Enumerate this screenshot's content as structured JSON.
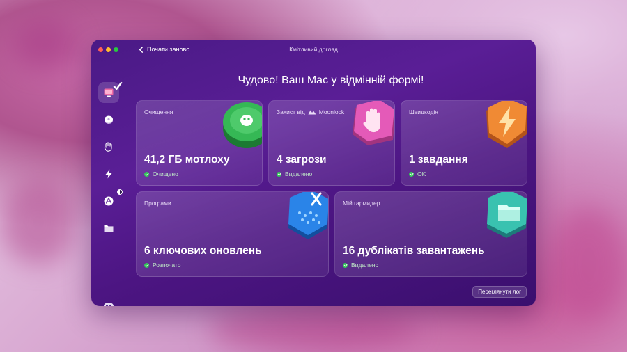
{
  "window": {
    "title": "Кмітливий догляд",
    "back_label": "Почати заново"
  },
  "headline": "Чудово! Ваш Mac у відмінній формі!",
  "sidebar": {
    "items": [
      {
        "name": "smart-care",
        "icon": "monitor-icon",
        "active": true,
        "badge": "checkmark"
      },
      {
        "name": "cleanup",
        "icon": "cleanup-disc-icon"
      },
      {
        "name": "protection",
        "icon": "hand-icon"
      },
      {
        "name": "performance",
        "icon": "lightning-icon"
      },
      {
        "name": "applications",
        "icon": "app-store-icon",
        "badge": "half-circle"
      },
      {
        "name": "my-clutter",
        "icon": "folder-icon"
      },
      {
        "name": "assistant",
        "icon": "assistant-eyes-icon"
      }
    ]
  },
  "cards": {
    "cleanup": {
      "label": "Очищення",
      "value": "41,2 ГБ мотлоху",
      "status": "Очищено"
    },
    "protection": {
      "label": "Захист від",
      "brand": "Moonlock",
      "value": "4 загрози",
      "status": "Видалено"
    },
    "speed": {
      "label": "Швидкодія",
      "value": "1 завдання",
      "status": "OK"
    },
    "apps": {
      "label": "Програми",
      "value": "6 ключових оновлень",
      "status": "Розпочато"
    },
    "clutter": {
      "label": "Мій гармидер",
      "value": "16 дублікатів завантажень",
      "status": "Видалено"
    }
  },
  "log_button": "Переглянути лог",
  "colors": {
    "window_bg": "#4a1a86",
    "status_green": "#34c759",
    "cleanup_art": "#2ea84a",
    "protection_art": "#e256b5",
    "speed_art": "#e07a2a",
    "apps_art": "#1e6fd8",
    "clutter_art": "#2fb6a8"
  }
}
